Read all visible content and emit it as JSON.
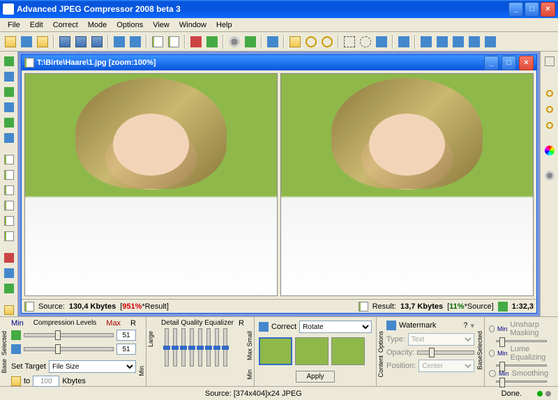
{
  "titlebar": {
    "title": "Advanced JPEG Compressor 2008 beta 3"
  },
  "menu": [
    "File",
    "Edit",
    "Correct",
    "Mode",
    "Options",
    "View",
    "Window",
    "Help"
  ],
  "document": {
    "title": "T:\\Birte\\Haare\\1.jpg  [zoom:100%]",
    "source_label": "Source:",
    "source_size": "130,4 Kbytes",
    "source_pct": "951%",
    "source_suffix": "*Result]",
    "result_label": "Result:",
    "result_size": "13,7 Kbytes",
    "result_pct": "11%",
    "result_suffix": "*Source]",
    "ratio": "1:32,3"
  },
  "compression": {
    "title": "Compression Levels",
    "min": "Min",
    "max": "Max",
    "r": "R",
    "val1": "51",
    "val2": "51",
    "set_target": "Set Target",
    "target_type": "File Size",
    "to": "to",
    "target_val": "100",
    "target_unit": "Kbytes",
    "base": "Base",
    "selected": "Selected"
  },
  "equalizer": {
    "title": "Detail Quality Equalizer",
    "large": "Large",
    "small": "Small",
    "r": "R",
    "min": "Min",
    "max": "Max"
  },
  "correct": {
    "label": "Correct",
    "selection": "Rotate",
    "apply": "Apply"
  },
  "watermark": {
    "label": "Watermark",
    "q": "?",
    "type_label": "Type:",
    "type_val": "Text",
    "opacity_label": "Opacity:",
    "position_label": "Position:",
    "position_val": "Center",
    "options": "Options",
    "content": "Content",
    "base": "Base",
    "selected": "Selected"
  },
  "sharpen": {
    "min": "Min",
    "unsharp": "Unsharp Masking",
    "lume": "Lume Equalizing",
    "smooth": "Smoothing"
  },
  "statusbar": {
    "source_info": "Source: [374x404]x24 JPEG",
    "done": "Done."
  }
}
